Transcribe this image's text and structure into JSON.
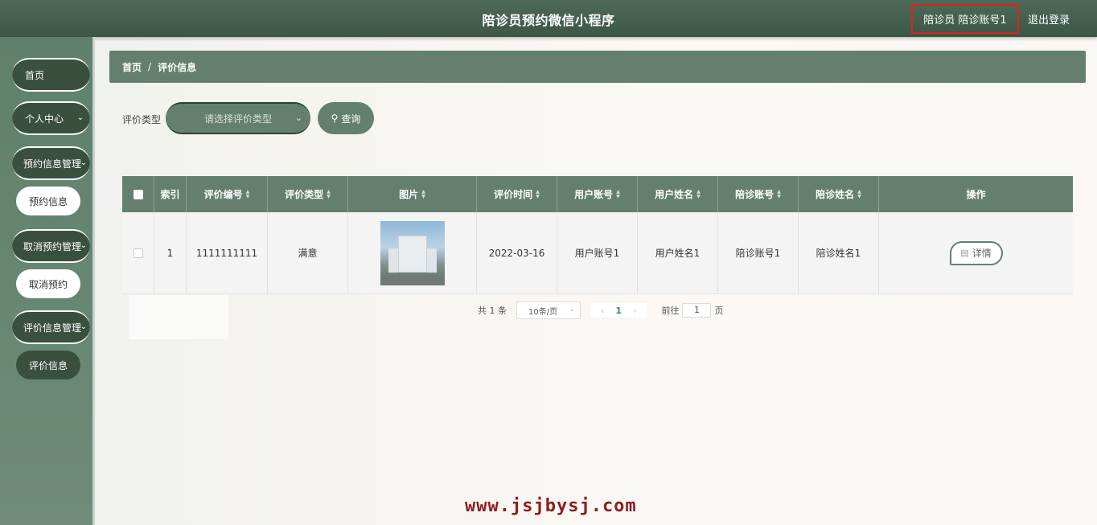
{
  "header": {
    "title": "陪诊员预约微信小程序",
    "user_label": "陪诊员 陪诊账号1",
    "logout_label": "退出登录"
  },
  "sidebar": {
    "items": [
      {
        "label": "首页",
        "type": "pill"
      },
      {
        "label": "个人中心",
        "type": "pill",
        "chevron": true
      },
      {
        "label": "预约信息管理",
        "type": "pill",
        "chevron": true
      },
      {
        "label": "预约信息",
        "type": "sub"
      },
      {
        "label": "取消预约管理",
        "type": "pill",
        "chevron": true
      },
      {
        "label": "取消预约",
        "type": "sub"
      },
      {
        "label": "评价信息管理",
        "type": "pill",
        "chevron": true
      },
      {
        "label": "评价信息",
        "type": "sub",
        "active": true
      }
    ]
  },
  "breadcrumb": {
    "home": "首页",
    "separator": "/",
    "current": "评价信息"
  },
  "search": {
    "label": "评价类型",
    "placeholder": "请选择评价类型",
    "button_label": "查询"
  },
  "table": {
    "columns": [
      "索引",
      "评价编号",
      "评价类型",
      "图片",
      "评价时间",
      "用户账号",
      "用户姓名",
      "陪诊账号",
      "陪诊姓名",
      "操作"
    ],
    "rows": [
      {
        "index": "1",
        "code": "1111111111",
        "type": "满意",
        "image_alt": "hospital-building",
        "time": "2022-03-16",
        "user_account": "用户账号1",
        "user_name": "用户姓名1",
        "escort_account": "陪诊账号1",
        "escort_name": "陪诊姓名1",
        "action_label": "详情"
      }
    ]
  },
  "pagination": {
    "total_label": "共 1 条",
    "page_size": "10条/页",
    "current_page": "1",
    "goto_label": "前往",
    "goto_value": "1",
    "page_suffix": "页"
  },
  "watermark": "www.jsjbysj.com",
  "colors": {
    "primary": "#647f6f",
    "dark": "#3a503f",
    "header": "#4d6a58",
    "highlight_border": "#e02020"
  }
}
